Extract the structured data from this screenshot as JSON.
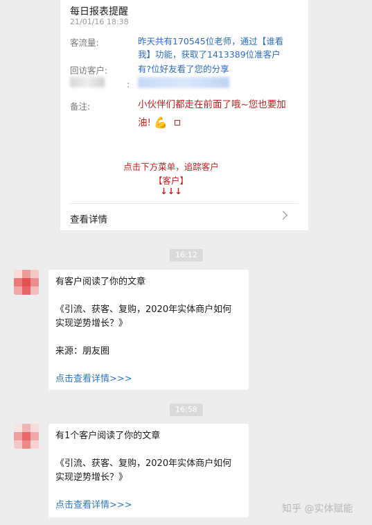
{
  "card": {
    "title": "每日报表提醒",
    "time": "21/01/16 18:38",
    "rows": [
      {
        "label": "客流量:",
        "value_line1": "昨天共有170545位老师，通过【谁看",
        "value_line2": "我】功能，获取了1413389位准客户"
      },
      {
        "label": "回访客户:",
        "value_line1": "有?位好友看了您的分享"
      }
    ],
    "remark_label": "备注:",
    "remark_line1": "小伙伴们都走在前面了哦~您也要加",
    "remark_line2": "油!",
    "remark_emoji": "💪",
    "promo_line1": "点击下方菜单，追踪客户",
    "promo_line2": "【客户】",
    "promo_line3": "↓↓↓",
    "details_label": "查看详情"
  },
  "times": [
    "16:12",
    "16:58"
  ],
  "messages": [
    {
      "title": "有客户阅读了你的文章",
      "article_line1": "《引流、获客、复购，2020年实体商户如何",
      "article_line2": "实现逆势增长？》",
      "source": "来源：朋友圈",
      "link": "点击查看详情>>>"
    },
    {
      "title": "有1个客户阅读了你的文章",
      "article_line1": "《引流、获客、复购，2020年实体商户如何",
      "article_line2": "实现逆势增长？》",
      "link": "点击查看详情>>>"
    }
  ],
  "watermark": "知乎 @实体赋能",
  "colors": {
    "link": "#2f78c4",
    "red": "#c81e1e",
    "background": "#ededed"
  }
}
